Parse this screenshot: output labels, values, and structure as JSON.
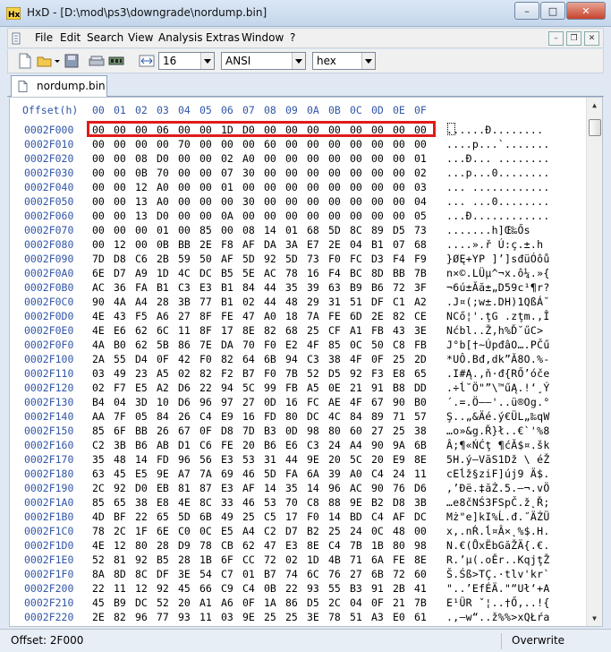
{
  "window": {
    "app_name": "HxD",
    "title": "HxD - [D:\\mod\\ps3\\downgrade\\nordump.bin]"
  },
  "menu": {
    "items": [
      "File",
      "Edit",
      "Search",
      "View",
      "Analysis",
      "Extras",
      "Window",
      "?"
    ]
  },
  "toolbar": {
    "bytes_per_row": "16",
    "charset": "ANSI",
    "offset_base": "hex"
  },
  "tab": {
    "label": "nordump.bin"
  },
  "editor": {
    "offset_header": "Offset(h)",
    "column_headers": [
      "00",
      "01",
      "02",
      "03",
      "04",
      "05",
      "06",
      "07",
      "08",
      "09",
      "0A",
      "0B",
      "0C",
      "0D",
      "0E",
      "0F"
    ],
    "rows": [
      {
        "offset": "0002F000",
        "bytes": [
          "00",
          "00",
          "00",
          "06",
          "00",
          "00",
          "1D",
          "D0",
          "00",
          "00",
          "00",
          "00",
          "00",
          "00",
          "00",
          "00"
        ],
        "ascii": "......Đ........"
      },
      {
        "offset": "0002F010",
        "bytes": [
          "00",
          "00",
          "00",
          "00",
          "70",
          "00",
          "00",
          "00",
          "60",
          "00",
          "00",
          "00",
          "00",
          "00",
          "00",
          "00"
        ],
        "ascii": "....p...`......."
      },
      {
        "offset": "0002F020",
        "bytes": [
          "00",
          "00",
          "08",
          "D0",
          "00",
          "00",
          "02",
          "A0",
          "00",
          "00",
          "00",
          "00",
          "00",
          "00",
          "00",
          "01"
        ],
        "ascii": "...Đ... ........"
      },
      {
        "offset": "0002F030",
        "bytes": [
          "00",
          "00",
          "0B",
          "70",
          "00",
          "00",
          "07",
          "30",
          "00",
          "00",
          "00",
          "00",
          "00",
          "00",
          "00",
          "02"
        ],
        "ascii": "...p...0........"
      },
      {
        "offset": "0002F040",
        "bytes": [
          "00",
          "00",
          "12",
          "A0",
          "00",
          "00",
          "01",
          "00",
          "00",
          "00",
          "00",
          "00",
          "00",
          "00",
          "00",
          "03"
        ],
        "ascii": "... ............"
      },
      {
        "offset": "0002F050",
        "bytes": [
          "00",
          "00",
          "13",
          "A0",
          "00",
          "00",
          "00",
          "30",
          "00",
          "00",
          "00",
          "00",
          "00",
          "00",
          "00",
          "04"
        ],
        "ascii": "... ...0........"
      },
      {
        "offset": "0002F060",
        "bytes": [
          "00",
          "00",
          "13",
          "D0",
          "00",
          "00",
          "0A",
          "00",
          "00",
          "00",
          "00",
          "00",
          "00",
          "00",
          "00",
          "05"
        ],
        "ascii": "...Đ............"
      },
      {
        "offset": "0002F070",
        "bytes": [
          "00",
          "00",
          "00",
          "01",
          "00",
          "85",
          "00",
          "08",
          "14",
          "01",
          "68",
          "5D",
          "8C",
          "89",
          "D5",
          "73"
        ],
        "ascii": ".......h]Œ‰Ős"
      },
      {
        "offset": "0002F080",
        "bytes": [
          "00",
          "12",
          "00",
          "0B",
          "BB",
          "2E",
          "F8",
          "AF",
          "DA",
          "3A",
          "E7",
          "2E",
          "04",
          "B1",
          "07",
          "68"
        ],
        "ascii": "....».ř Ú:ç.±.h"
      },
      {
        "offset": "0002F090",
        "bytes": [
          "7D",
          "D8",
          "C6",
          "2B",
          "59",
          "50",
          "AF",
          "5D",
          "92",
          "5D",
          "73",
          "F0",
          "FC",
          "D3",
          "F4",
          "F9"
        ],
        "ascii": "}ØĘ+YP ]’]sđüÓôů"
      },
      {
        "offset": "0002F0A0",
        "bytes": [
          "6E",
          "D7",
          "A9",
          "1D",
          "4C",
          "DC",
          "B5",
          "5E",
          "AC",
          "78",
          "16",
          "F4",
          "BC",
          "8D",
          "BB",
          "7B"
        ],
        "ascii": "n×©.LÜµ^¬x.ô¼.»{"
      },
      {
        "offset": "0002F0B0",
        "bytes": [
          "AC",
          "36",
          "FA",
          "B1",
          "C3",
          "E3",
          "B1",
          "84",
          "44",
          "35",
          "39",
          "63",
          "B9",
          "B6",
          "72",
          "3F"
        ],
        "ascii": "¬6ú±Ăă±„D59c¹¶r?"
      },
      {
        "offset": "0002F0C0",
        "bytes": [
          "90",
          "4A",
          "A4",
          "28",
          "3B",
          "77",
          "B1",
          "02",
          "44",
          "48",
          "29",
          "31",
          "51",
          "DF",
          "C1",
          "A2"
        ],
        "ascii": ".J¤(;w±.DH)1QßÁ˘"
      },
      {
        "offset": "0002F0D0",
        "bytes": [
          "4E",
          "43",
          "F5",
          "A6",
          "27",
          "8F",
          "FE",
          "47",
          "A0",
          "18",
          "7A",
          "FE",
          "6D",
          "2E",
          "82",
          "CE"
        ],
        "ascii": "NCő¦'.ţG .zţm.‚Î"
      },
      {
        "offset": "0002F0E0",
        "bytes": [
          "4E",
          "E6",
          "62",
          "6C",
          "11",
          "8F",
          "17",
          "8E",
          "82",
          "68",
          "25",
          "CF",
          "A1",
          "FB",
          "43",
          "3E"
        ],
        "ascii": "Nćbl..Ž‚h%Ď˘űC>"
      },
      {
        "offset": "0002F0F0",
        "bytes": [
          "4A",
          "B0",
          "62",
          "5B",
          "86",
          "7E",
          "DA",
          "70",
          "F0",
          "E2",
          "4F",
          "85",
          "0C",
          "50",
          "C8",
          "FB"
        ],
        "ascii": "J°b[†~ÚpđâO….PČű"
      },
      {
        "offset": "0002F100",
        "bytes": [
          "2A",
          "55",
          "D4",
          "0F",
          "42",
          "F0",
          "82",
          "64",
          "6B",
          "94",
          "C3",
          "38",
          "4F",
          "0F",
          "25",
          "2D"
        ],
        "ascii": "*UÔ.Bđ‚dk”Ă8O.%-"
      },
      {
        "offset": "0002F110",
        "bytes": [
          "03",
          "49",
          "23",
          "A5",
          "02",
          "82",
          "F2",
          "B7",
          "F0",
          "7B",
          "52",
          "D5",
          "92",
          "F3",
          "E8",
          "65"
        ],
        "ascii": ".I#Ą.‚ň·đ{RŐ’óče"
      },
      {
        "offset": "0002F120",
        "bytes": [
          "02",
          "F7",
          "E5",
          "A2",
          "D6",
          "22",
          "94",
          "5C",
          "99",
          "FB",
          "A5",
          "0E",
          "21",
          "91",
          "B8",
          "DD"
        ],
        "ascii": ".÷ĺ˘Ö\"”\\™űĄ.!‘¸Ý"
      },
      {
        "offset": "0002F130",
        "bytes": [
          "B4",
          "04",
          "3D",
          "10",
          "D6",
          "96",
          "97",
          "27",
          "0D",
          "16",
          "FC",
          "AE",
          "4F",
          "67",
          "90",
          "B0"
        ],
        "ascii": "´.=.Ö–—'..ü®Og.°"
      },
      {
        "offset": "0002F140",
        "bytes": [
          "AA",
          "7F",
          "05",
          "84",
          "26",
          "C4",
          "E9",
          "16",
          "FD",
          "80",
          "DC",
          "4C",
          "84",
          "89",
          "71",
          "57"
        ],
        "ascii": "Ş..„&Äé.ý€ÜL„‰qW"
      },
      {
        "offset": "0002F150",
        "bytes": [
          "85",
          "6F",
          "BB",
          "26",
          "67",
          "0F",
          "D8",
          "7D",
          "B3",
          "0D",
          "98",
          "80",
          "60",
          "27",
          "25",
          "38"
        ],
        "ascii": "…o»&g.Ř}ł..€`'%8"
      },
      {
        "offset": "0002F160",
        "bytes": [
          "C2",
          "3B",
          "B6",
          "AB",
          "D1",
          "C6",
          "FE",
          "20",
          "B6",
          "E6",
          "C3",
          "24",
          "A4",
          "90",
          "9A",
          "6B"
        ],
        "ascii": "Â;¶«ŃĆţ ¶ćĂ$¤.šk"
      },
      {
        "offset": "0002F170",
        "bytes": [
          "35",
          "48",
          "14",
          "FD",
          "96",
          "56",
          "E3",
          "53",
          "31",
          "44",
          "9E",
          "20",
          "5C",
          "20",
          "E9",
          "8E"
        ],
        "ascii": "5H.ý–VăS1Dž \\ éŽ"
      },
      {
        "offset": "0002F180",
        "bytes": [
          "63",
          "45",
          "E5",
          "9E",
          "A7",
          "7A",
          "69",
          "46",
          "5D",
          "FA",
          "6A",
          "39",
          "A0",
          "C4",
          "24",
          "11"
        ],
        "ascii": "cEĺž§ziF]új9 Ä$."
      },
      {
        "offset": "0002F190",
        "bytes": [
          "2C",
          "92",
          "D0",
          "EB",
          "81",
          "87",
          "E3",
          "AF",
          "14",
          "35",
          "14",
          "96",
          "AC",
          "90",
          "76",
          "D6"
        ],
        "ascii": ",’Đë.‡ăŻ.5.–¬.vÖ"
      },
      {
        "offset": "0002F1A0",
        "bytes": [
          "85",
          "65",
          "38",
          "E8",
          "4E",
          "8C",
          "33",
          "46",
          "53",
          "70",
          "C8",
          "88",
          "9E",
          "B2",
          "D8",
          "3B"
        ],
        "ascii": "…e8čNŚ3FSpČ.ž˛Ř;"
      },
      {
        "offset": "0002F1B0",
        "bytes": [
          "4D",
          "BF",
          "22",
          "65",
          "5D",
          "6B",
          "49",
          "25",
          "C5",
          "17",
          "F0",
          "14",
          "BD",
          "C4",
          "AF",
          "DC"
        ],
        "ascii": "Mż\"e]kI%Ĺ.đ.˝ÄŻÜ"
      },
      {
        "offset": "0002F1C0",
        "bytes": [
          "78",
          "2C",
          "1F",
          "6E",
          "C0",
          "0C",
          "E5",
          "A4",
          "C2",
          "D7",
          "B2",
          "25",
          "24",
          "0C",
          "48",
          "00"
        ],
        "ascii": "x,.nŔ.ĺ¤Â×˛%$.H."
      },
      {
        "offset": "0002F1D0",
        "bytes": [
          "4E",
          "12",
          "80",
          "28",
          "D9",
          "78",
          "CB",
          "62",
          "47",
          "E3",
          "8E",
          "C4",
          "7B",
          "1B",
          "80",
          "98"
        ],
        "ascii": "N.€(ŮxËbGăŽÄ{.€."
      },
      {
        "offset": "0002F1E0",
        "bytes": [
          "52",
          "81",
          "92",
          "B5",
          "28",
          "1B",
          "6F",
          "CC",
          "72",
          "02",
          "1D",
          "4B",
          "71",
          "6A",
          "FE",
          "8E"
        ],
        "ascii": "R.’µ(.oĚr..KqjţŽ"
      },
      {
        "offset": "0002F1F0",
        "bytes": [
          "8A",
          "8D",
          "8C",
          "DF",
          "3E",
          "54",
          "C7",
          "01",
          "B7",
          "74",
          "6C",
          "76",
          "27",
          "6B",
          "72",
          "60"
        ],
        "ascii": "Š.Śß>TÇ.·tlv'kr`"
      },
      {
        "offset": "0002F200",
        "bytes": [
          "22",
          "11",
          "12",
          "92",
          "45",
          "66",
          "C9",
          "C4",
          "0B",
          "22",
          "93",
          "55",
          "B3",
          "91",
          "2B",
          "41"
        ],
        "ascii": "\"..’EfÉÄ.\"“Uł‘+A"
      },
      {
        "offset": "0002F210",
        "bytes": [
          "45",
          "B9",
          "DC",
          "52",
          "20",
          "A1",
          "A6",
          "0F",
          "1A",
          "86",
          "D5",
          "2C",
          "04",
          "0F",
          "21",
          "7B"
        ],
        "ascii": "E¹ÜR ˇ¦..†Ő,..!{"
      },
      {
        "offset": "0002F220",
        "bytes": [
          "2E",
          "82",
          "96",
          "77",
          "93",
          "11",
          "03",
          "9E",
          "25",
          "25",
          "3E",
          "78",
          "51",
          "A3",
          "E0",
          "61"
        ],
        "ascii": ".‚–w“..ž%%>xQŁŕa"
      }
    ]
  },
  "status": {
    "offset": "Offset: 2F000",
    "mode": "Overwrite"
  }
}
